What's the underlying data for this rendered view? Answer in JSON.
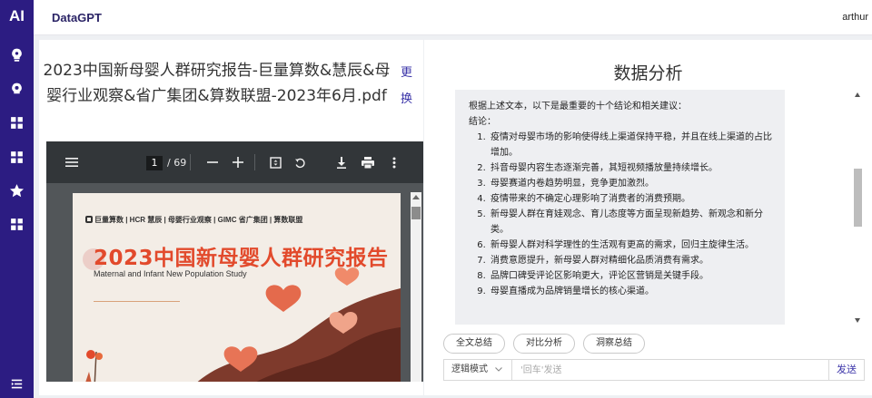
{
  "app": {
    "logo": "AI",
    "brand": "DataGPT",
    "user": "arthur"
  },
  "rail": {
    "icons": [
      "bulb-icon",
      "bulb-outline-icon",
      "grid-icon",
      "grid-icon",
      "star-icon",
      "grid-icon"
    ],
    "bottom_icon": "menu-collapse-icon"
  },
  "document": {
    "title": "2023中国新母婴人群研究报告-巨量算数&慧辰&母婴行业观察&省广集团&算数联盟-2023年6月.pdf",
    "title_action": "更换"
  },
  "pdf_viewer": {
    "page_current": "1",
    "page_total": "/ 69",
    "cover": {
      "logos": "巨量算数 | HCR 慧辰 | 母婴行业观察 | GIMC 省广集团 | 算数联盟",
      "title": "2023中国新母婴人群研究报告",
      "subtitle": "Maternal and Infant New Population Study"
    },
    "toolbar_icons": [
      "menu-icon",
      "zoom-out-icon",
      "zoom-in-icon",
      "fit-page-icon",
      "rotate-icon",
      "download-icon",
      "print-icon",
      "more-icon"
    ]
  },
  "analysis": {
    "title": "数据分析",
    "intro": "根据上述文本，以下是最重要的十个结论和相关建议：",
    "label": "结论：",
    "items": [
      "疫情对母婴市场的影响使得线上渠道保持平稳，并且在线上渠道的占比增加。",
      "抖音母婴内容生态逐渐完善，其短视频播放量持续增长。",
      "母婴赛道内卷趋势明显，竞争更加激烈。",
      "疫情带来的不确定心理影响了消费者的消费预期。",
      "新母婴人群在育娃观念、育儿态度等方面呈现新趋势、新观念和新分类。",
      "新母婴人群对科学理性的生活观有更高的需求，回归主旋律生活。",
      "消费意愿提升，新母婴人群对精细化品质消费有需求。",
      "品牌口碑受评论区影响更大，评论区营销是关键手段。",
      "母婴直播成为品牌销量增长的核心渠道。"
    ]
  },
  "actions": {
    "summary": "全文总结",
    "compare": "对比分析",
    "insight": "洞察总结"
  },
  "input": {
    "mode": "逻辑模式",
    "placeholder": "'回车'发送",
    "send": "发送"
  },
  "colors": {
    "rail": "#2c1c82",
    "accent": "#3a33a8",
    "cover_title": "#e24a2c",
    "pdf_toolbar": "#323639",
    "pdf_background": "#525659"
  }
}
